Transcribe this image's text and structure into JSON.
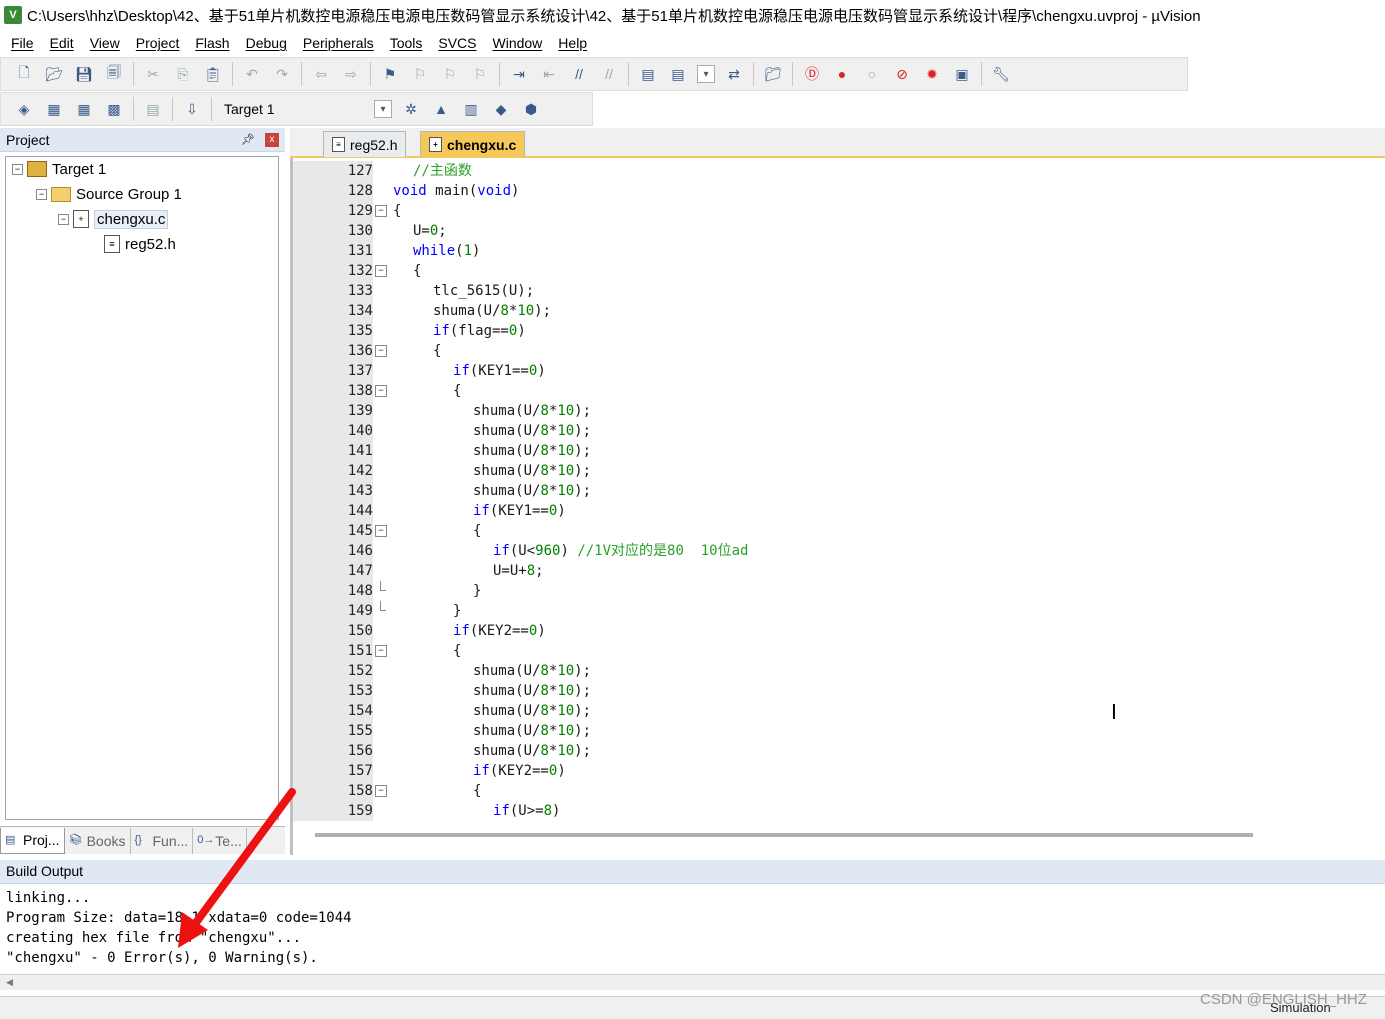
{
  "window": {
    "title": "C:\\Users\\hhz\\Desktop\\42、基于51单片机数控电源稳压电源电压数码管显示系统设计\\42、基于51单片机数控电源稳压电源电压数码管显示系统设计\\程序\\chengxu.uvproj - µVision",
    "app_icon": "V"
  },
  "menu": [
    "File",
    "Edit",
    "View",
    "Project",
    "Flash",
    "Debug",
    "Peripherals",
    "Tools",
    "SVCS",
    "Window",
    "Help"
  ],
  "toolbar1": {
    "icons": [
      "new-file",
      "open-folder",
      "save",
      "save-all",
      "cut",
      "copy",
      "paste",
      "undo",
      "redo",
      "nav-back",
      "nav-forward",
      "bookmark",
      "prev-bookmark",
      "next-bookmark",
      "clear-bookmarks",
      "indent",
      "unindent",
      "comment",
      "uncomment",
      "find-in-files",
      "find-select",
      "incremental-find",
      "browse",
      "debug-start",
      "breakpoint-insert",
      "breakpoint-disable",
      "breakpoint-kill",
      "breakpoint-remove",
      "window-layout",
      "configure-wrench"
    ]
  },
  "toolbar2": {
    "target": "Target 1",
    "icons": [
      "translate",
      "build",
      "rebuild",
      "batch-build",
      "stop-build",
      "download",
      "target-options",
      "manage-components",
      "select-packs",
      "pack-installer",
      "run-time-env"
    ]
  },
  "project_panel": {
    "title": "Project",
    "pin": "ᵖ",
    "close": "x",
    "tree": [
      {
        "label": "Target 1",
        "level": 0,
        "kind": "target",
        "expander": "−"
      },
      {
        "label": "Source Group 1",
        "level": 1,
        "kind": "folder",
        "expander": "−"
      },
      {
        "label": "chengxu.c",
        "level": 2,
        "kind": "file",
        "expander": "−",
        "selected": true
      },
      {
        "label": "reg52.h",
        "level": 3,
        "kind": "header",
        "expander": ""
      }
    ],
    "tabs": [
      {
        "label": "Proj...",
        "icon": "project-icon",
        "active": true
      },
      {
        "label": "Books",
        "icon": "books-icon",
        "active": false
      },
      {
        "label": "Fun...",
        "icon": "functions-icon",
        "active": false
      },
      {
        "label": "Te...",
        "icon": "templates-icon",
        "active": false
      }
    ]
  },
  "editor": {
    "tabs": [
      {
        "label": "reg52.h",
        "active": false
      },
      {
        "label": "chengxu.c",
        "active": true
      }
    ],
    "lines": [
      {
        "n": "127",
        "fold": "",
        "indent": 1,
        "parts": [
          [
            "cmt",
            "//主函数"
          ]
        ]
      },
      {
        "n": "128",
        "fold": "",
        "indent": 0,
        "parts": [
          [
            "kw",
            "void"
          ],
          [
            "txt",
            " main("
          ],
          [
            "kw",
            "void"
          ],
          [
            "txt",
            ")"
          ]
        ]
      },
      {
        "n": "129",
        "fold": "box",
        "indent": 0,
        "parts": [
          [
            "txt",
            "{"
          ]
        ]
      },
      {
        "n": "130",
        "fold": "",
        "indent": 1,
        "parts": [
          [
            "txt",
            "U="
          ],
          [
            "num",
            "0"
          ],
          [
            "txt",
            ";"
          ]
        ]
      },
      {
        "n": "131",
        "fold": "",
        "indent": 1,
        "parts": [
          [
            "kw",
            "while"
          ],
          [
            "txt",
            "("
          ],
          [
            "num",
            "1"
          ],
          [
            "txt",
            ")"
          ]
        ]
      },
      {
        "n": "132",
        "fold": "box",
        "indent": 1,
        "parts": [
          [
            "txt",
            "{"
          ]
        ]
      },
      {
        "n": "133",
        "fold": "",
        "indent": 2,
        "parts": [
          [
            "txt",
            "tlc_5615(U);"
          ]
        ]
      },
      {
        "n": "134",
        "fold": "",
        "indent": 2,
        "parts": [
          [
            "txt",
            "shuma(U/"
          ],
          [
            "num",
            "8"
          ],
          [
            "txt",
            "*"
          ],
          [
            "num",
            "10"
          ],
          [
            "txt",
            ");"
          ]
        ]
      },
      {
        "n": "135",
        "fold": "",
        "indent": 2,
        "parts": [
          [
            "kw",
            "if"
          ],
          [
            "txt",
            "(flag=="
          ],
          [
            "num",
            "0"
          ],
          [
            "txt",
            ")"
          ]
        ]
      },
      {
        "n": "136",
        "fold": "box",
        "indent": 2,
        "parts": [
          [
            "txt",
            "{"
          ]
        ]
      },
      {
        "n": "137",
        "fold": "",
        "indent": 3,
        "parts": [
          [
            "kw",
            "if"
          ],
          [
            "txt",
            "(KEY1=="
          ],
          [
            "num",
            "0"
          ],
          [
            "txt",
            ")"
          ]
        ]
      },
      {
        "n": "138",
        "fold": "box",
        "indent": 3,
        "parts": [
          [
            "txt",
            "{"
          ]
        ]
      },
      {
        "n": "139",
        "fold": "",
        "indent": 4,
        "parts": [
          [
            "txt",
            "shuma(U/"
          ],
          [
            "num",
            "8"
          ],
          [
            "txt",
            "*"
          ],
          [
            "num",
            "10"
          ],
          [
            "txt",
            ");"
          ]
        ]
      },
      {
        "n": "140",
        "fold": "",
        "indent": 4,
        "parts": [
          [
            "txt",
            "shuma(U/"
          ],
          [
            "num",
            "8"
          ],
          [
            "txt",
            "*"
          ],
          [
            "num",
            "10"
          ],
          [
            "txt",
            ");"
          ]
        ]
      },
      {
        "n": "141",
        "fold": "",
        "indent": 4,
        "parts": [
          [
            "txt",
            "shuma(U/"
          ],
          [
            "num",
            "8"
          ],
          [
            "txt",
            "*"
          ],
          [
            "num",
            "10"
          ],
          [
            "txt",
            ");"
          ]
        ]
      },
      {
        "n": "142",
        "fold": "",
        "indent": 4,
        "parts": [
          [
            "txt",
            "shuma(U/"
          ],
          [
            "num",
            "8"
          ],
          [
            "txt",
            "*"
          ],
          [
            "num",
            "10"
          ],
          [
            "txt",
            ");"
          ]
        ]
      },
      {
        "n": "143",
        "fold": "",
        "indent": 4,
        "parts": [
          [
            "txt",
            "shuma(U/"
          ],
          [
            "num",
            "8"
          ],
          [
            "txt",
            "*"
          ],
          [
            "num",
            "10"
          ],
          [
            "txt",
            ");"
          ]
        ]
      },
      {
        "n": "144",
        "fold": "",
        "indent": 4,
        "parts": [
          [
            "kw",
            "if"
          ],
          [
            "txt",
            "(KEY1=="
          ],
          [
            "num",
            "0"
          ],
          [
            "txt",
            ")"
          ]
        ]
      },
      {
        "n": "145",
        "fold": "box",
        "indent": 4,
        "parts": [
          [
            "txt",
            "{"
          ]
        ]
      },
      {
        "n": "146",
        "fold": "",
        "indent": 5,
        "parts": [
          [
            "kw",
            "if"
          ],
          [
            "txt",
            "(U<"
          ],
          [
            "num",
            "960"
          ],
          [
            "txt",
            ") "
          ],
          [
            "cmt",
            "//1V对应的是80  10位ad"
          ]
        ]
      },
      {
        "n": "147",
        "fold": "",
        "indent": 5,
        "parts": [
          [
            "txt",
            "U=U+"
          ],
          [
            "num",
            "8"
          ],
          [
            "txt",
            ";"
          ]
        ]
      },
      {
        "n": "148",
        "fold": "end",
        "indent": 4,
        "parts": [
          [
            "txt",
            "}"
          ]
        ]
      },
      {
        "n": "149",
        "fold": "end",
        "indent": 3,
        "parts": [
          [
            "txt",
            "}"
          ]
        ]
      },
      {
        "n": "150",
        "fold": "",
        "indent": 3,
        "parts": [
          [
            "kw",
            "if"
          ],
          [
            "txt",
            "(KEY2=="
          ],
          [
            "num",
            "0"
          ],
          [
            "txt",
            ")"
          ]
        ]
      },
      {
        "n": "151",
        "fold": "box",
        "indent": 3,
        "parts": [
          [
            "txt",
            "{"
          ]
        ]
      },
      {
        "n": "152",
        "fold": "",
        "indent": 4,
        "parts": [
          [
            "txt",
            "shuma(U/"
          ],
          [
            "num",
            "8"
          ],
          [
            "txt",
            "*"
          ],
          [
            "num",
            "10"
          ],
          [
            "txt",
            ");"
          ]
        ]
      },
      {
        "n": "153",
        "fold": "",
        "indent": 4,
        "parts": [
          [
            "txt",
            "shuma(U/"
          ],
          [
            "num",
            "8"
          ],
          [
            "txt",
            "*"
          ],
          [
            "num",
            "10"
          ],
          [
            "txt",
            ");"
          ]
        ]
      },
      {
        "n": "154",
        "fold": "",
        "indent": 4,
        "parts": [
          [
            "txt",
            "shuma(U/"
          ],
          [
            "num",
            "8"
          ],
          [
            "txt",
            "*"
          ],
          [
            "num",
            "10"
          ],
          [
            "txt",
            ");"
          ]
        ]
      },
      {
        "n": "155",
        "fold": "",
        "indent": 4,
        "parts": [
          [
            "txt",
            "shuma(U/"
          ],
          [
            "num",
            "8"
          ],
          [
            "txt",
            "*"
          ],
          [
            "num",
            "10"
          ],
          [
            "txt",
            ");"
          ]
        ]
      },
      {
        "n": "156",
        "fold": "",
        "indent": 4,
        "parts": [
          [
            "txt",
            "shuma(U/"
          ],
          [
            "num",
            "8"
          ],
          [
            "txt",
            "*"
          ],
          [
            "num",
            "10"
          ],
          [
            "txt",
            ");"
          ]
        ]
      },
      {
        "n": "157",
        "fold": "",
        "indent": 4,
        "parts": [
          [
            "kw",
            "if"
          ],
          [
            "txt",
            "(KEY2=="
          ],
          [
            "num",
            "0"
          ],
          [
            "txt",
            ")"
          ]
        ]
      },
      {
        "n": "158",
        "fold": "box",
        "indent": 4,
        "parts": [
          [
            "txt",
            "{"
          ]
        ]
      },
      {
        "n": "159",
        "fold": "",
        "indent": 5,
        "parts": [
          [
            "kw",
            "if"
          ],
          [
            "txt",
            "(U>="
          ],
          [
            "num",
            "8"
          ],
          [
            "txt",
            ")"
          ]
        ]
      }
    ]
  },
  "build_output": {
    "title": "Build Output",
    "lines": [
      "linking...",
      "Program Size: data=18.1 xdata=0 code=1044",
      "creating hex file from \"chengxu\"...",
      "\"chengxu\" - 0 Error(s), 0 Warning(s)."
    ]
  },
  "status": {
    "mode": "Simulation"
  },
  "watermark": "CSDN @ENGLISH_HHZ",
  "colors": {
    "keyword": "#0000ff",
    "number": "#008000",
    "comment": "#2aa02a",
    "annotation_arrow": "#ee1111",
    "active_tab": "#f5c85a",
    "panel_header": "#dfe8f3"
  }
}
